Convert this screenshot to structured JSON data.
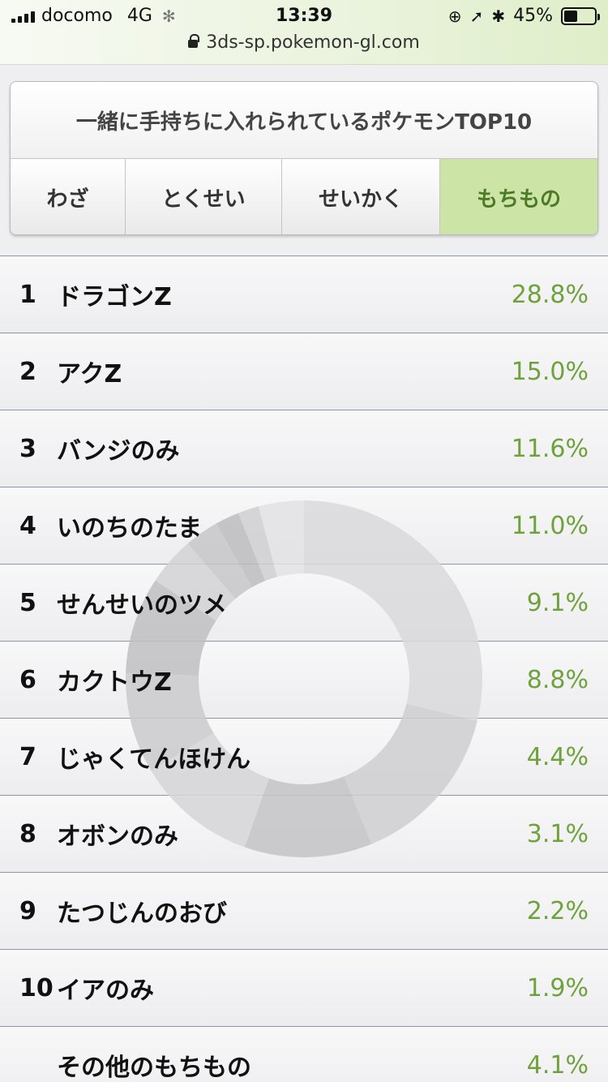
{
  "status_bar": {
    "carrier": "docomo",
    "network": "4G",
    "time": "13:39",
    "battery": "45%",
    "battery_level": 0.45
  },
  "url_bar": {
    "url": "3ds-sp.pokemon-gl.com"
  },
  "header": {
    "title": "一緒に手持ちに入れられているポケモンTOP10",
    "tabs": [
      {
        "label": "わざ",
        "active": false
      },
      {
        "label": "とくせい",
        "active": false
      },
      {
        "label": "せいかく",
        "active": false
      },
      {
        "label": "もちもの",
        "active": true
      }
    ]
  },
  "ranking": [
    {
      "rank": "1",
      "name": "ドラゴンZ",
      "percent": "28.8%"
    },
    {
      "rank": "2",
      "name": "アクZ",
      "percent": "15.0%"
    },
    {
      "rank": "3",
      "name": "バンジのみ",
      "percent": "11.6%"
    },
    {
      "rank": "4",
      "name": "いのちのたま",
      "percent": "11.0%"
    },
    {
      "rank": "5",
      "name": "せんせいのツメ",
      "percent": "9.1%"
    },
    {
      "rank": "6",
      "name": "カクトウZ",
      "percent": "8.8%"
    },
    {
      "rank": "7",
      "name": "じゃくてんほけん",
      "percent": "4.4%"
    },
    {
      "rank": "8",
      "name": "オボンのみ",
      "percent": "3.1%"
    },
    {
      "rank": "9",
      "name": "たつじんのおび",
      "percent": "2.2%"
    },
    {
      "rank": "10",
      "name": "イアのみ",
      "percent": "1.9%"
    },
    {
      "rank": "",
      "name": "その他のもちもの",
      "percent": "4.1%"
    }
  ],
  "donut": {
    "values": [
      28.8,
      15.0,
      11.6,
      11.0,
      9.1,
      8.8,
      4.4,
      3.1,
      2.2,
      1.9,
      4.1
    ],
    "colors": [
      "#dadadc",
      "#cfcfd1",
      "#c4c4c6",
      "#d6d6d8",
      "#cbcbcd",
      "#c0c0c2",
      "#d3d3d5",
      "#c7c7c9",
      "#bdbdbf",
      "#d0d0d2",
      "#e3e3e5"
    ]
  },
  "colors": {
    "accent": "#6ea23c",
    "active_tab_bg": "#cde4a7",
    "active_tab_text": "#4d7a26"
  }
}
